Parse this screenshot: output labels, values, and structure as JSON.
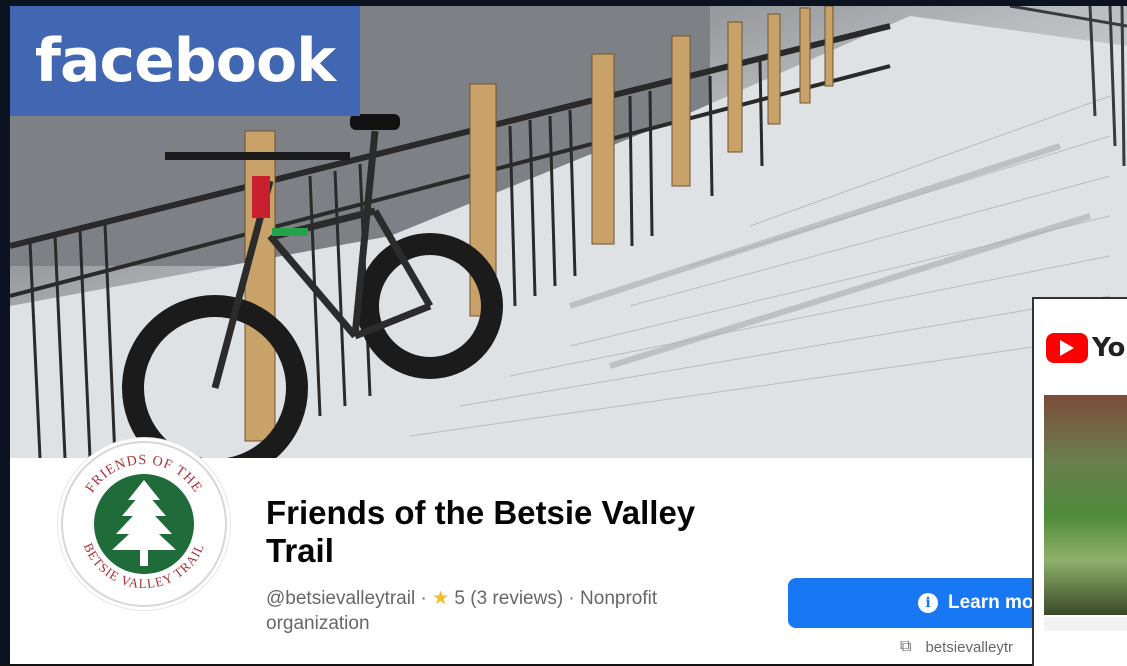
{
  "cover": {
    "logo_text": "facebook"
  },
  "page": {
    "name": "Friends of the Betsie Valley Trail",
    "handle": "@betsievalleytrail",
    "separator": " · ",
    "rating_icon": "star-icon",
    "rating": "5 (3 reviews)",
    "category": "Nonprofit organization"
  },
  "avatar": {
    "logo_top_text": "FRIENDS OF THE",
    "logo_bottom_text": "BETSIE VALLEY TRAIL"
  },
  "actions": {
    "learn_more_label": "Learn mo",
    "website_text": "betsievalleytr"
  },
  "youtube": {
    "logo_text": "Yo"
  },
  "colors": {
    "facebook_blue": "#4267b2",
    "button_blue": "#1877f2",
    "youtube_red": "#ff0000",
    "star": "#f7b928"
  }
}
